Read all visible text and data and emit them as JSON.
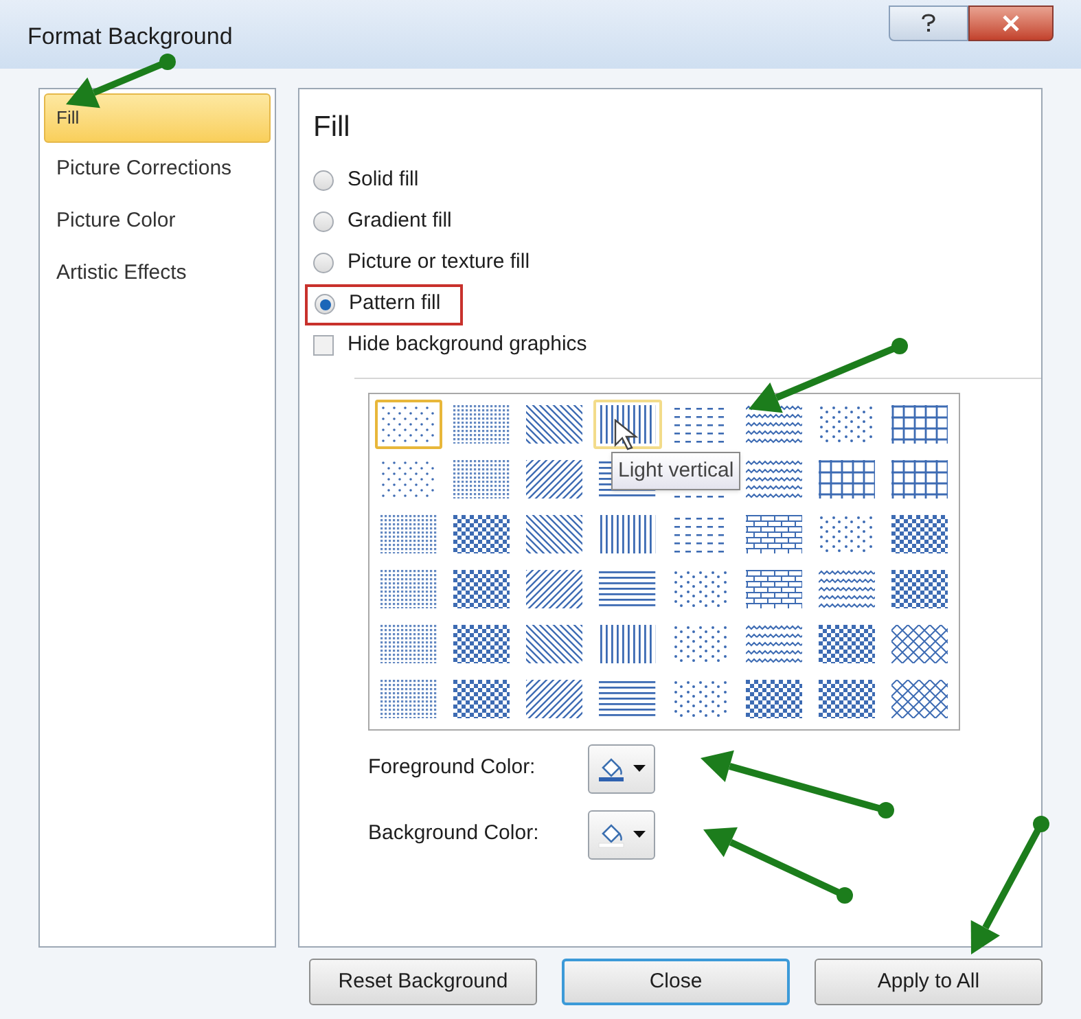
{
  "window": {
    "title": "Format Background"
  },
  "sidebar": {
    "items": [
      {
        "label": "Fill",
        "selected": true
      },
      {
        "label": "Picture Corrections",
        "selected": false
      },
      {
        "label": "Picture Color",
        "selected": false
      },
      {
        "label": "Artistic Effects",
        "selected": false
      }
    ]
  },
  "panel": {
    "heading": "Fill",
    "options": [
      {
        "kind": "radio",
        "label": "Solid fill",
        "checked": false,
        "highlighted": false
      },
      {
        "kind": "radio",
        "label": "Gradient fill",
        "checked": false,
        "highlighted": false
      },
      {
        "kind": "radio",
        "label": "Picture or texture fill",
        "checked": false,
        "highlighted": false
      },
      {
        "kind": "radio",
        "label": "Pattern fill",
        "checked": true,
        "highlighted": true
      },
      {
        "kind": "checkbox",
        "label": "Hide background graphics",
        "checked": false,
        "highlighted": false
      }
    ],
    "patterns": [
      {
        "kind": "dots",
        "selected": true,
        "hovered": false
      },
      {
        "kind": "dense",
        "selected": false,
        "hovered": false
      },
      {
        "kind": "diag-down",
        "selected": false,
        "hovered": false
      },
      {
        "kind": "vertical",
        "selected": false,
        "hovered": true
      },
      {
        "kind": "dashes",
        "selected": false,
        "hovered": false
      },
      {
        "kind": "waves",
        "selected": false,
        "hovered": false
      },
      {
        "kind": "scatter",
        "selected": false,
        "hovered": false
      },
      {
        "kind": "grid",
        "selected": false,
        "hovered": false
      },
      {
        "kind": "dots",
        "selected": false,
        "hovered": false
      },
      {
        "kind": "dense",
        "selected": false,
        "hovered": false
      },
      {
        "kind": "diag-up",
        "selected": false,
        "hovered": false
      },
      {
        "kind": "horizontal",
        "selected": false,
        "hovered": false
      },
      {
        "kind": "dashes",
        "selected": false,
        "hovered": false
      },
      {
        "kind": "waves",
        "selected": false,
        "hovered": false
      },
      {
        "kind": "grid",
        "selected": false,
        "hovered": false
      },
      {
        "kind": "grid",
        "selected": false,
        "hovered": false
      },
      {
        "kind": "dense",
        "selected": false,
        "hovered": false
      },
      {
        "kind": "checker",
        "selected": false,
        "hovered": false
      },
      {
        "kind": "diag-down",
        "selected": false,
        "hovered": false
      },
      {
        "kind": "vertical",
        "selected": false,
        "hovered": false
      },
      {
        "kind": "dashes",
        "selected": false,
        "hovered": false
      },
      {
        "kind": "bricks",
        "selected": false,
        "hovered": false
      },
      {
        "kind": "scatter",
        "selected": false,
        "hovered": false
      },
      {
        "kind": "checker",
        "selected": false,
        "hovered": false
      },
      {
        "kind": "dense",
        "selected": false,
        "hovered": false
      },
      {
        "kind": "checker",
        "selected": false,
        "hovered": false
      },
      {
        "kind": "diag-up",
        "selected": false,
        "hovered": false
      },
      {
        "kind": "horizontal",
        "selected": false,
        "hovered": false
      },
      {
        "kind": "scatter",
        "selected": false,
        "hovered": false
      },
      {
        "kind": "bricks",
        "selected": false,
        "hovered": false
      },
      {
        "kind": "waves",
        "selected": false,
        "hovered": false
      },
      {
        "kind": "checker",
        "selected": false,
        "hovered": false
      },
      {
        "kind": "dense",
        "selected": false,
        "hovered": false
      },
      {
        "kind": "checker",
        "selected": false,
        "hovered": false
      },
      {
        "kind": "diag-down",
        "selected": false,
        "hovered": false
      },
      {
        "kind": "vertical",
        "selected": false,
        "hovered": false
      },
      {
        "kind": "scatter",
        "selected": false,
        "hovered": false
      },
      {
        "kind": "waves",
        "selected": false,
        "hovered": false
      },
      {
        "kind": "checker",
        "selected": false,
        "hovered": false
      },
      {
        "kind": "diamond",
        "selected": false,
        "hovered": false
      },
      {
        "kind": "dense",
        "selected": false,
        "hovered": false
      },
      {
        "kind": "checker",
        "selected": false,
        "hovered": false
      },
      {
        "kind": "diag-up",
        "selected": false,
        "hovered": false
      },
      {
        "kind": "horizontal",
        "selected": false,
        "hovered": false
      },
      {
        "kind": "scatter",
        "selected": false,
        "hovered": false
      },
      {
        "kind": "checker",
        "selected": false,
        "hovered": false
      },
      {
        "kind": "checker",
        "selected": false,
        "hovered": false
      },
      {
        "kind": "diamond",
        "selected": false,
        "hovered": false
      }
    ],
    "tooltip": "Light vertical",
    "colors": [
      {
        "label": "Foreground Color:",
        "kind": "foreground"
      },
      {
        "label": "Background Color:",
        "kind": "background"
      }
    ]
  },
  "buttons": [
    {
      "label": "Reset Background",
      "default": false
    },
    {
      "label": "Close",
      "default": true
    },
    {
      "label": "Apply to All",
      "default": false
    }
  ]
}
